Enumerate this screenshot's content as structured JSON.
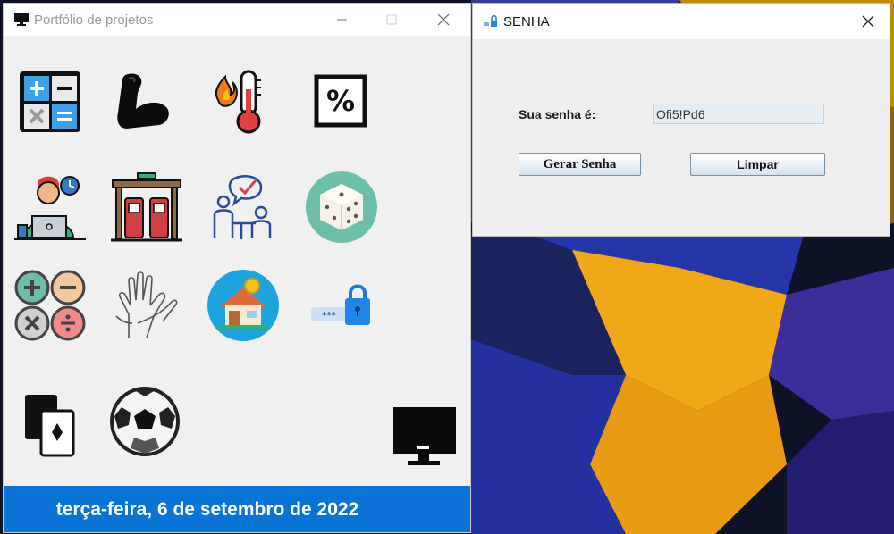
{
  "portfolio": {
    "title": "Portfólio de projetos",
    "date": "terça-feira, 6 de setembro de 2022",
    "icons": [
      "calculator-icon",
      "muscle-icon",
      "thermometer-icon",
      "percent-icon",
      "worker-laptop-icon",
      "gas-station-icon",
      "survey-icon",
      "dice-icon",
      "math-operations-icon",
      "hands-icon",
      "house-savings-icon",
      "password-lock-icon",
      "playing-cards-icon",
      "soccer-ball-icon",
      "monitor-icon"
    ]
  },
  "senha": {
    "title": "SENHA",
    "label": "Sua senha é:",
    "password": "Ofi5!Pd6",
    "gerar_label": "Gerar Senha",
    "limpar_label": "Limpar"
  },
  "colors": {
    "date_bar": "#0a74d6",
    "desktop_bg": "#0b1020"
  }
}
